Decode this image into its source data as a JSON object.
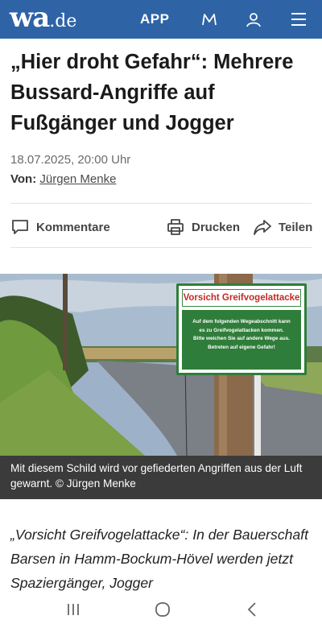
{
  "header": {
    "logo_main": "wa",
    "logo_tld": ".de",
    "app_label": "APP",
    "icons": [
      "m-icon",
      "user-icon",
      "menu-icon"
    ],
    "bg_color": "#2e63a6"
  },
  "article": {
    "headline": "„Hier droht Gefahr“: Mehrere Bussard-Angriffe auf Fußgänger und Jogger",
    "date": "18.07.2025, 20:00 Uhr",
    "author_prefix": "Von:",
    "author_name": "Jürgen Menke"
  },
  "actions": {
    "comments": "Kommentare",
    "print": "Drucken",
    "share": "Teilen"
  },
  "image": {
    "sign_title": "Vorsicht Greifvogelattacke",
    "sign_line1": "Auf dem folgenden Wegeabschnitt kann",
    "sign_line2": "es zu Greifvogelattacken kommen.",
    "sign_line3": "Bitte weichen Sie auf andere Wege aus.",
    "sign_line4": "Betreten auf eigene Gefahr!",
    "caption": "Mit diesem Schild wird vor gefiederten Angriffen aus der Luft gewarnt. © Jürgen Menke"
  },
  "body": {
    "intro": "„Vorsicht Greifvogelattacke“: In der Bauerschaft Barsen in Hamm-Bockum-Hövel werden jetzt Spaziergänger, Jogger"
  },
  "system_nav": {
    "icons": [
      "recent-apps-icon",
      "home-icon",
      "back-icon"
    ]
  }
}
